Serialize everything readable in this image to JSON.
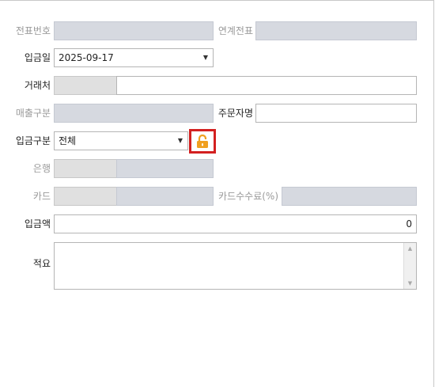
{
  "form": {
    "voucher_no_label": "전표번호",
    "linked_voucher_label": "연계전표",
    "deposit_date_label": "입금일",
    "deposit_date_value": "2025-09-17",
    "client_label": "거래처",
    "sales_type_label": "매출구분",
    "orderer_label": "주문자명",
    "deposit_type_label": "입금구분",
    "deposit_type_value": "전체",
    "bank_label": "은행",
    "card_label": "카드",
    "card_fee_label": "카드수수료(%)",
    "amount_label": "입금액",
    "amount_value": "0",
    "memo_label": "적요"
  },
  "icons": {
    "dropdown": "chevron-down-icon",
    "lock": "unlock-icon",
    "scroll_up": "scroll-up-arrow",
    "scroll_down": "scroll-down-arrow"
  },
  "colors": {
    "highlight_border": "#d32020",
    "lock_orange": "#f0a020",
    "readonly_fill": "#d6d9e0"
  }
}
